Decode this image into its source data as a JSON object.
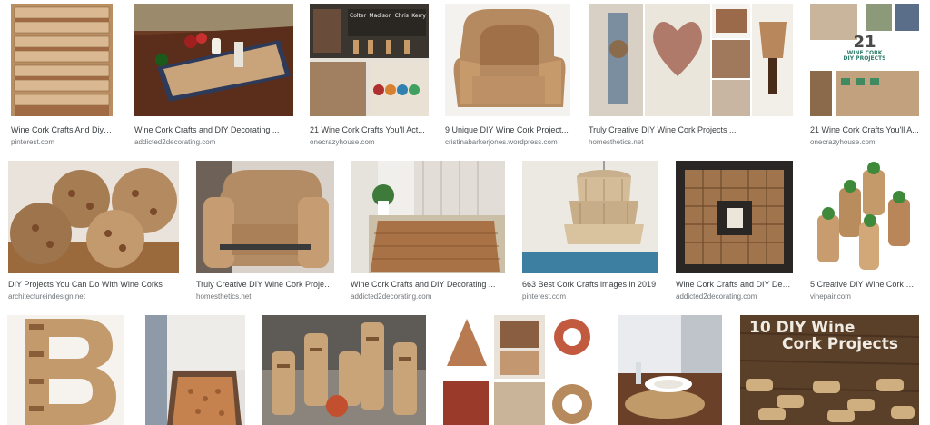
{
  "results": [
    {
      "title": "Wine Cork Crafts And Diy D...",
      "source": "pinterest.com",
      "alt": "cork-stair-risers-image"
    },
    {
      "title": "Wine Cork Crafts and DIY Decorating ...",
      "source": "addicted2decorating.com",
      "alt": "cork-table-runner-image"
    },
    {
      "title": "21 Wine Cork Crafts You'll Act...",
      "source": "onecrazyhouse.com",
      "alt": "cork-collage-image",
      "overlay_labels": [
        "Colter",
        "Madison",
        "Chris",
        "Kerry"
      ]
    },
    {
      "title": "9 Unique DIY Wine Cork Project...",
      "source": "cristinabarkerjones.wordpress.com",
      "alt": "cork-armchair-image"
    },
    {
      "title": "Truly Creative DIY Wine Cork Projects ...",
      "source": "homesthetics.net",
      "alt": "cork-projects-collage-image"
    },
    {
      "title": "21 Wine Cork Crafts You'll A...",
      "source": "onecrazyhouse.com",
      "alt": "cork-poster-image",
      "overlay_lines": [
        "21",
        "WINE CORK",
        "DIY PROJECTS"
      ]
    },
    {
      "title": "DIY Projects You Can Do With Wine Corks",
      "source": "architectureindesign.net",
      "alt": "cork-balls-image"
    },
    {
      "title": "Truly Creative DIY Wine Cork Projec...",
      "source": "homesthetics.net",
      "alt": "cork-chair-image"
    },
    {
      "title": "Wine Cork Crafts and DIY Decorating ...",
      "source": "addicted2decorating.com",
      "alt": "cork-bath-mat-image"
    },
    {
      "title": "663 Best Cork Crafts images in 2019",
      "source": "pinterest.com",
      "alt": "cork-chandelier-image"
    },
    {
      "title": "Wine Cork Crafts and DIY Dec...",
      "source": "addicted2decorating.com",
      "alt": "cork-frame-image"
    },
    {
      "title": "5 Creative DIY Wine Cork Pr...",
      "source": "vinepair.com",
      "alt": "cork-planters-image"
    },
    {
      "title": "",
      "source": "",
      "alt": "cork-letter-image"
    },
    {
      "title": "",
      "source": "",
      "alt": "cork-doormat-image"
    },
    {
      "title": "",
      "source": "",
      "alt": "cork-tiki-figures-image"
    },
    {
      "title": "",
      "source": "",
      "alt": "cork-wreaths-collage-image"
    },
    {
      "title": "",
      "source": "",
      "alt": "cork-placemat-image"
    },
    {
      "title": "",
      "source": "",
      "alt": "cork-projects-banner-image",
      "overlay_lines": [
        "10 DIY Wine",
        "Cork Projects"
      ]
    }
  ]
}
